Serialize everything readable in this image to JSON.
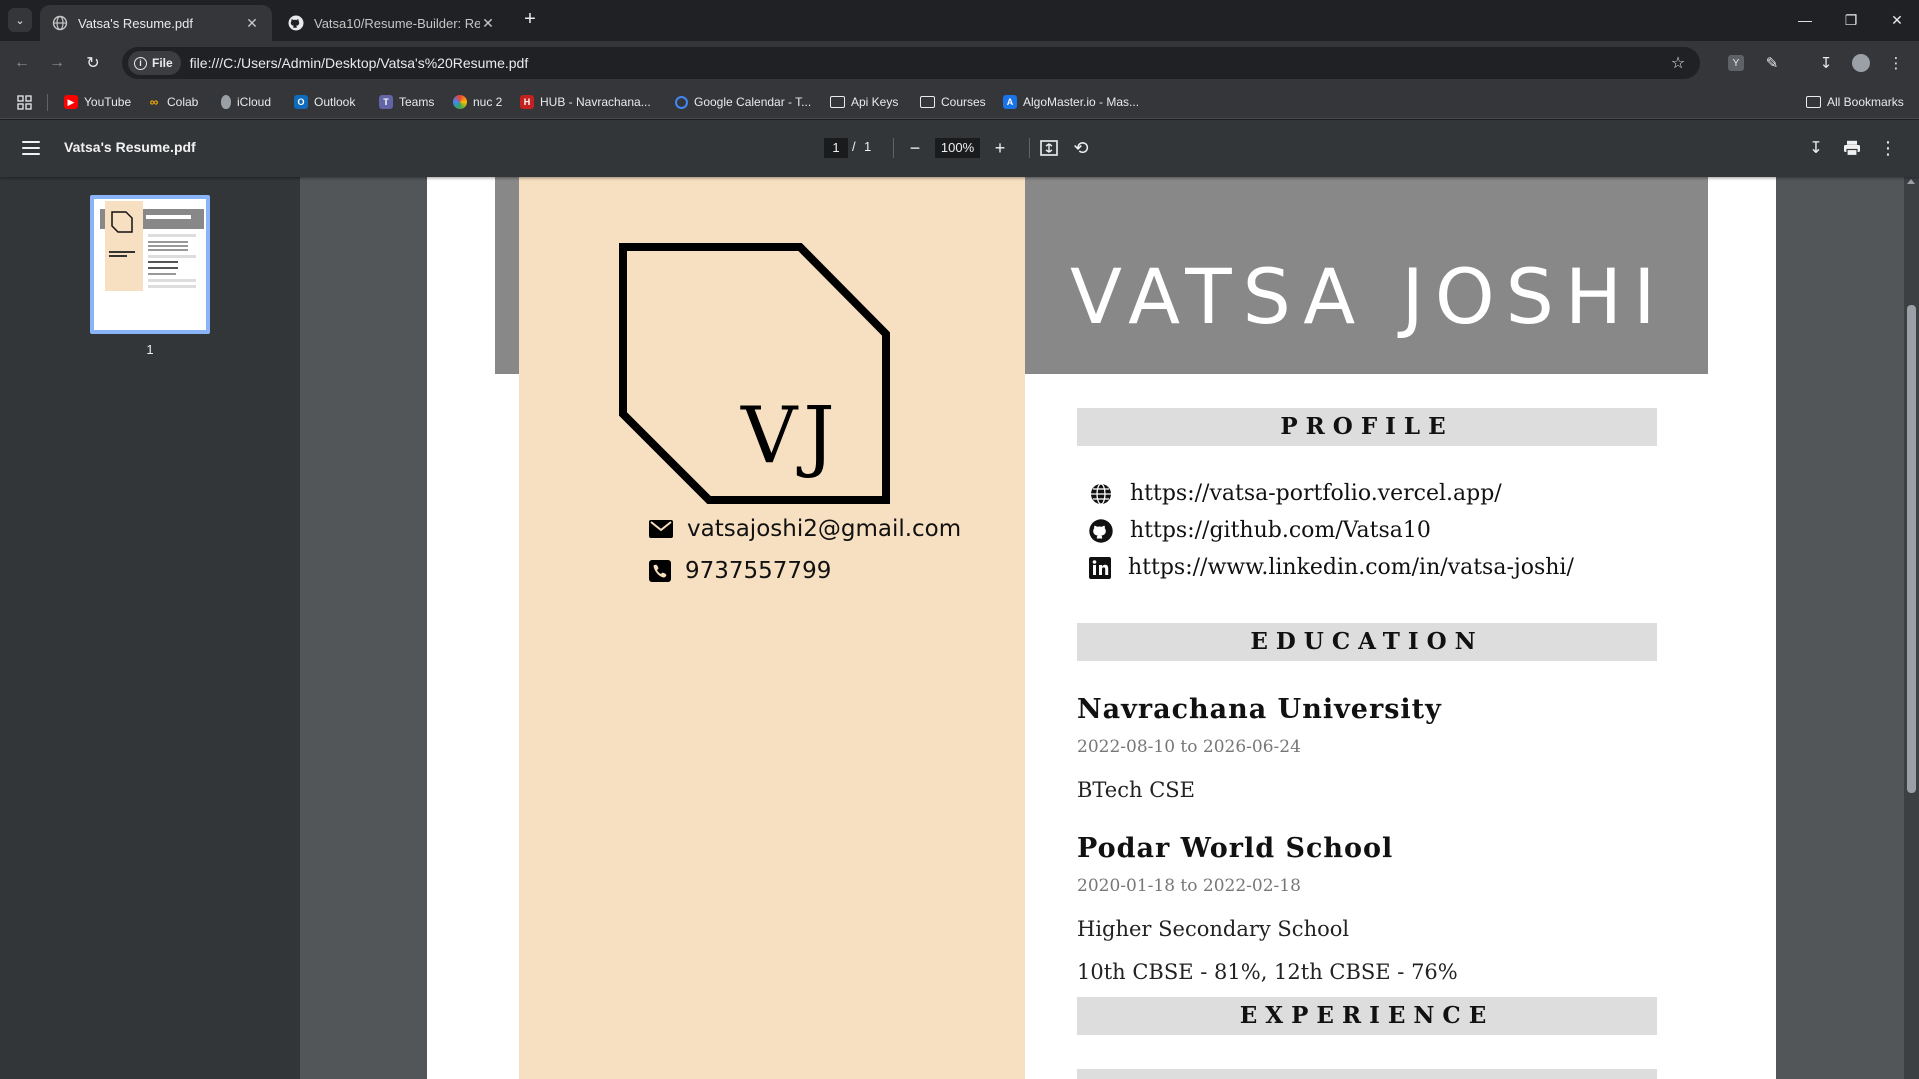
{
  "browser": {
    "tabs": [
      {
        "title": "Vatsa's Resume.pdf",
        "active": true
      },
      {
        "title": "Vatsa10/Resume-Builder: Resum",
        "active": false
      }
    ],
    "url_chip": "File",
    "url": "file:///C:/Users/Admin/Desktop/Vatsa's%20Resume.pdf",
    "profile_badge": "Y"
  },
  "bookmarks": {
    "items": [
      {
        "label": "YouTube",
        "icon": "youtube-icon",
        "color": "#ff0000"
      },
      {
        "label": "Colab",
        "icon": "colab-icon",
        "color": "#f9ab00"
      },
      {
        "label": "iCloud",
        "icon": "apple-icon",
        "color": "#9aa0a6"
      },
      {
        "label": "Outlook",
        "icon": "outlook-icon",
        "color": "#0f6cbd"
      },
      {
        "label": "Teams",
        "icon": "teams-icon",
        "color": "#6264a7"
      },
      {
        "label": "nuc 2",
        "icon": "nuc-icon",
        "color": "#e94235"
      },
      {
        "label": "HUB - Navrachana...",
        "icon": "hub-icon",
        "color": "#c5221f"
      },
      {
        "label": "Google Calendar - T...",
        "icon": "google-icon",
        "color": "#4285f4"
      },
      {
        "label": "Api Keys",
        "icon": "folder-icon"
      },
      {
        "label": "Courses",
        "icon": "folder-icon"
      },
      {
        "label": "AlgoMaster.io - Mas...",
        "icon": "algomaster-icon",
        "color": "#1a73e8"
      }
    ],
    "all_bookmarks": "All Bookmarks"
  },
  "pdf_viewer": {
    "title": "Vatsa's Resume.pdf",
    "page_current": "1",
    "page_separator": "/",
    "page_total": "1",
    "zoom": "100%",
    "thumbnail_label": "1"
  },
  "resume": {
    "name": "VATSA JOSHI",
    "monogram": "VJ",
    "email": "vatsajoshi2@gmail.com",
    "phone": "9737557799",
    "sections": {
      "profile": "PROFILE",
      "education": "EDUCATION",
      "experience": "EXPERIENCE"
    },
    "links": {
      "portfolio": "https://vatsa-portfolio.vercel.app/",
      "github": "https://github.com/Vatsa10",
      "linkedin": "https://www.linkedin.com/in/vatsa-joshi/"
    },
    "education": [
      {
        "institution": "Navrachana University",
        "dates": "2022-08-10  to  2026-06-24",
        "details": [
          "BTech CSE"
        ]
      },
      {
        "institution": "Podar World School",
        "dates": "2020-01-18  to  2022-02-18",
        "details": [
          "Higher Secondary School",
          "10th CBSE - 81%, 12th CBSE - 76%"
        ]
      }
    ],
    "colors": {
      "header_band": "#888888",
      "left_column": "#f7dfc1",
      "section_bar": "#dddddd"
    }
  }
}
